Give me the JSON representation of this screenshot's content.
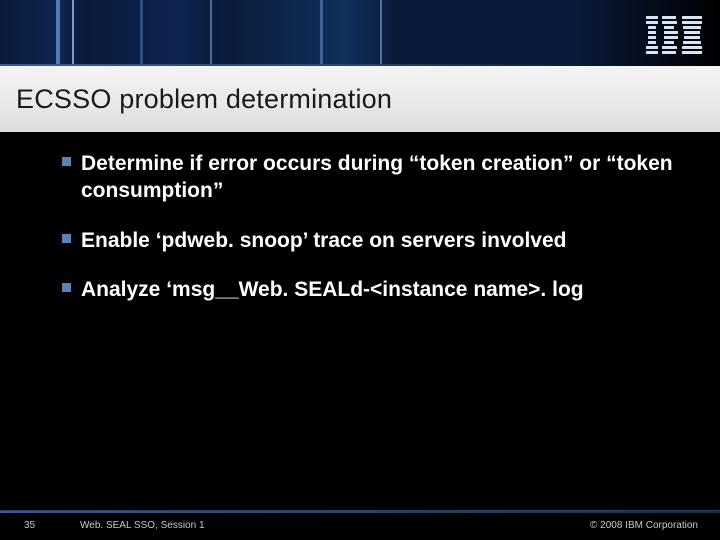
{
  "header": {
    "logo_name": "IBM"
  },
  "title": "ECSSO problem determination",
  "bullets": [
    "Determine if error occurs during “token creation” or “token consumption”",
    "Enable ‘pdweb. snoop’ trace on servers involved",
    "Analyze ‘msg__Web. SEALd-<instance name>. log"
  ],
  "footer": {
    "slide_number": "35",
    "session": "Web. SEAL SSO, Session 1",
    "copyright": "© 2008 IBM Corporation"
  }
}
